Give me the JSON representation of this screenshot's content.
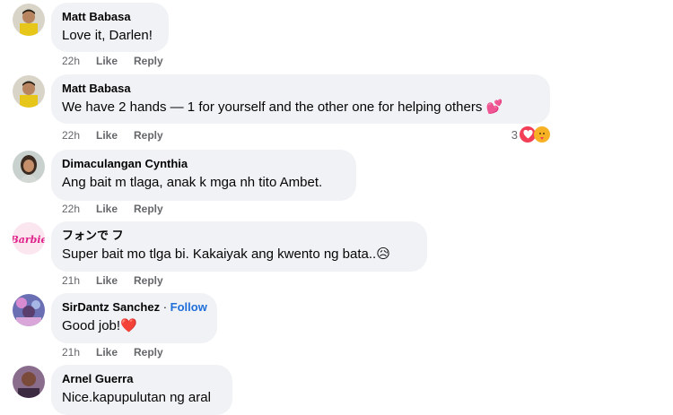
{
  "comments": [
    {
      "name": "Matt Babasa",
      "text": "Love it, Darlen!",
      "emoji": "",
      "time": "22h",
      "like": "Like",
      "reply": "Reply"
    },
    {
      "name": "Matt Babasa",
      "text": "We have 2 hands — 1 for yourself and the other one for helping others",
      "emoji": "💕",
      "time": "22h",
      "like": "Like",
      "reply": "Reply",
      "reaction_count": "3"
    },
    {
      "name": "Dimaculangan Cynthia",
      "text": "Ang bait m tlaga, anak k mga nh tito Ambet.",
      "emoji": "",
      "time": "22h",
      "like": "Like",
      "reply": "Reply"
    },
    {
      "name": "フォンで フ",
      "text": "Super bait mo tlga bi. Kakaiyak ang kwento ng bata..",
      "emoji": "😥",
      "time": "21h",
      "like": "Like",
      "reply": "Reply"
    },
    {
      "name": "SirDantz Sanchez",
      "follow_sep": " · ",
      "follow": "Follow",
      "text": "Good job!",
      "emoji": "❤️",
      "time": "21h",
      "like": "Like",
      "reply": "Reply"
    },
    {
      "name": "Arnel Guerra",
      "text": "Nice.kapupulutan ng aral",
      "emoji": ""
    }
  ],
  "avatars": {
    "barbie_logo_text": "Barbie"
  },
  "colors": {
    "bubble": "#f0f2f5",
    "meta": "#65676b",
    "follow": "#216fdb"
  }
}
